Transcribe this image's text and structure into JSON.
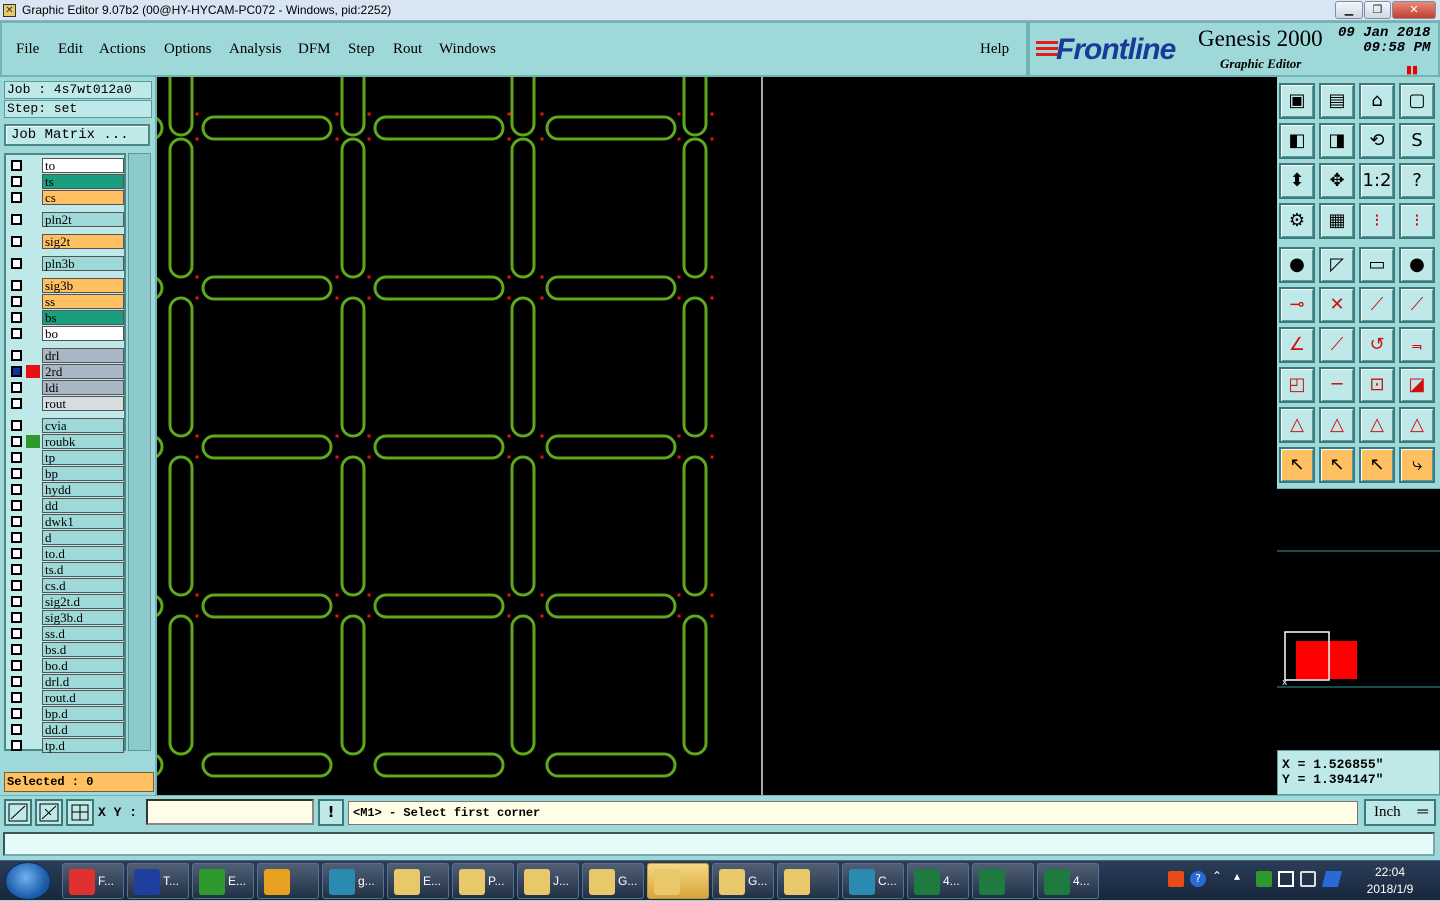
{
  "window": {
    "title": "Graphic Editor 9.07b2 (00@HY-HYCAM-PC072 - Windows, pid:2252)"
  },
  "menu": {
    "items": [
      "File",
      "Edit",
      "Actions",
      "Options",
      "Analysis",
      "DFM",
      "Step",
      "Rout",
      "Windows"
    ],
    "help": "Help"
  },
  "brand": {
    "logo": "Frontline",
    "product": "Genesis 2000",
    "subtitle": "Graphic Editor",
    "date": "09 Jan 2018",
    "time": "09:58 PM"
  },
  "job": {
    "job_line": "Job : 4s7wt012a0",
    "step_line": "Step: set",
    "matrix_button": "Job Matrix ..."
  },
  "layers": [
    {
      "name": "to",
      "color": "#ffffff",
      "swatch": ""
    },
    {
      "name": "ts",
      "color": "#1a9e7e",
      "swatch": ""
    },
    {
      "name": "cs",
      "color": "#ffc062",
      "swatch": ""
    },
    {
      "name": "pln2t",
      "color": "#9fd8d8",
      "swatch": ""
    },
    {
      "name": "sig2t",
      "color": "#ffc062",
      "swatch": ""
    },
    {
      "name": "pln3b",
      "color": "#9fd8d8",
      "swatch": ""
    },
    {
      "name": "sig3b",
      "color": "#ffc062",
      "swatch": ""
    },
    {
      "name": "ss",
      "color": "#ffc062",
      "swatch": ""
    },
    {
      "name": "bs",
      "color": "#1a9e7e",
      "swatch": ""
    },
    {
      "name": "bo",
      "color": "#ffffff",
      "swatch": ""
    },
    {
      "name": "drl",
      "color": "#a9b7c4",
      "swatch": ""
    },
    {
      "name": "2rd",
      "color": "#a9b7c4",
      "swatch": "#e81010",
      "active": true
    },
    {
      "name": "ldi",
      "color": "#a9b7c4",
      "swatch": ""
    },
    {
      "name": "rout",
      "color": "#d8dde0",
      "swatch": ""
    },
    {
      "name": "cvia",
      "color": "#9fd8d8",
      "swatch": ""
    },
    {
      "name": "roubk",
      "color": "#9fd8d8",
      "swatch": "#2e9a2e"
    },
    {
      "name": "tp",
      "color": "#9fd8d8",
      "swatch": ""
    },
    {
      "name": "bp",
      "color": "#9fd8d8",
      "swatch": ""
    },
    {
      "name": "hydd",
      "color": "#9fd8d8",
      "swatch": ""
    },
    {
      "name": "dd",
      "color": "#9fd8d8",
      "swatch": ""
    },
    {
      "name": "dwk1",
      "color": "#9fd8d8",
      "swatch": ""
    },
    {
      "name": "d",
      "color": "#9fd8d8",
      "swatch": ""
    },
    {
      "name": "to.d",
      "color": "#9fd8d8",
      "swatch": ""
    },
    {
      "name": "ts.d",
      "color": "#9fd8d8",
      "swatch": ""
    },
    {
      "name": "cs.d",
      "color": "#9fd8d8",
      "swatch": ""
    },
    {
      "name": "sig2t.d",
      "color": "#9fd8d8",
      "swatch": ""
    },
    {
      "name": "sig3b.d",
      "color": "#9fd8d8",
      "swatch": ""
    },
    {
      "name": "ss.d",
      "color": "#9fd8d8",
      "swatch": ""
    },
    {
      "name": "bs.d",
      "color": "#9fd8d8",
      "swatch": ""
    },
    {
      "name": "bo.d",
      "color": "#9fd8d8",
      "swatch": ""
    },
    {
      "name": "drl.d",
      "color": "#9fd8d8",
      "swatch": ""
    },
    {
      "name": "rout.d",
      "color": "#9fd8d8",
      "swatch": ""
    },
    {
      "name": "bp.d",
      "color": "#9fd8d8",
      "swatch": ""
    },
    {
      "name": "dd.d",
      "color": "#9fd8d8",
      "swatch": ""
    },
    {
      "name": "tp.d",
      "color": "#9fd8d8",
      "swatch": ""
    }
  ],
  "selected": "Selected : 0",
  "coords": {
    "x": "X = 1.526855\"",
    "y": "Y = 1.394147\""
  },
  "status": {
    "xy_label": "X Y :",
    "xy_value": "",
    "prompt": "<M1> - Select first corner",
    "unit": "Inch"
  },
  "colors": {
    "panel": "#9fd8d8",
    "canvas": "#000000",
    "rout_path": "#5fa81c",
    "marker": "#e81010",
    "highlight": "#ffc062"
  },
  "taskbar": {
    "items": [
      {
        "label": "F...",
        "icon": "#e03030"
      },
      {
        "label": "T...",
        "icon": "#2040a0"
      },
      {
        "label": "E...",
        "icon": "#2e9a2e"
      },
      {
        "label": "",
        "icon": "#e8a020"
      },
      {
        "label": "g...",
        "icon": "#2a8ab0"
      },
      {
        "label": "E...",
        "icon": "#e8c86a"
      },
      {
        "label": "P...",
        "icon": "#e8c86a"
      },
      {
        "label": "J...",
        "icon": "#e8c86a"
      },
      {
        "label": "G...",
        "icon": "#e8c86a"
      },
      {
        "label": "",
        "icon": "#e8c86a",
        "active": true
      },
      {
        "label": "G...",
        "icon": "#e8c86a"
      },
      {
        "label": "",
        "icon": "#e8c86a"
      },
      {
        "label": "C...",
        "icon": "#2a8ab0"
      },
      {
        "label": "4...",
        "icon": "#1e7a3e"
      },
      {
        "label": "",
        "icon": "#1e7a3e"
      },
      {
        "label": "4...",
        "icon": "#1e7a3e"
      }
    ],
    "clock_time": "22:04",
    "clock_date": "2018/1/9"
  }
}
